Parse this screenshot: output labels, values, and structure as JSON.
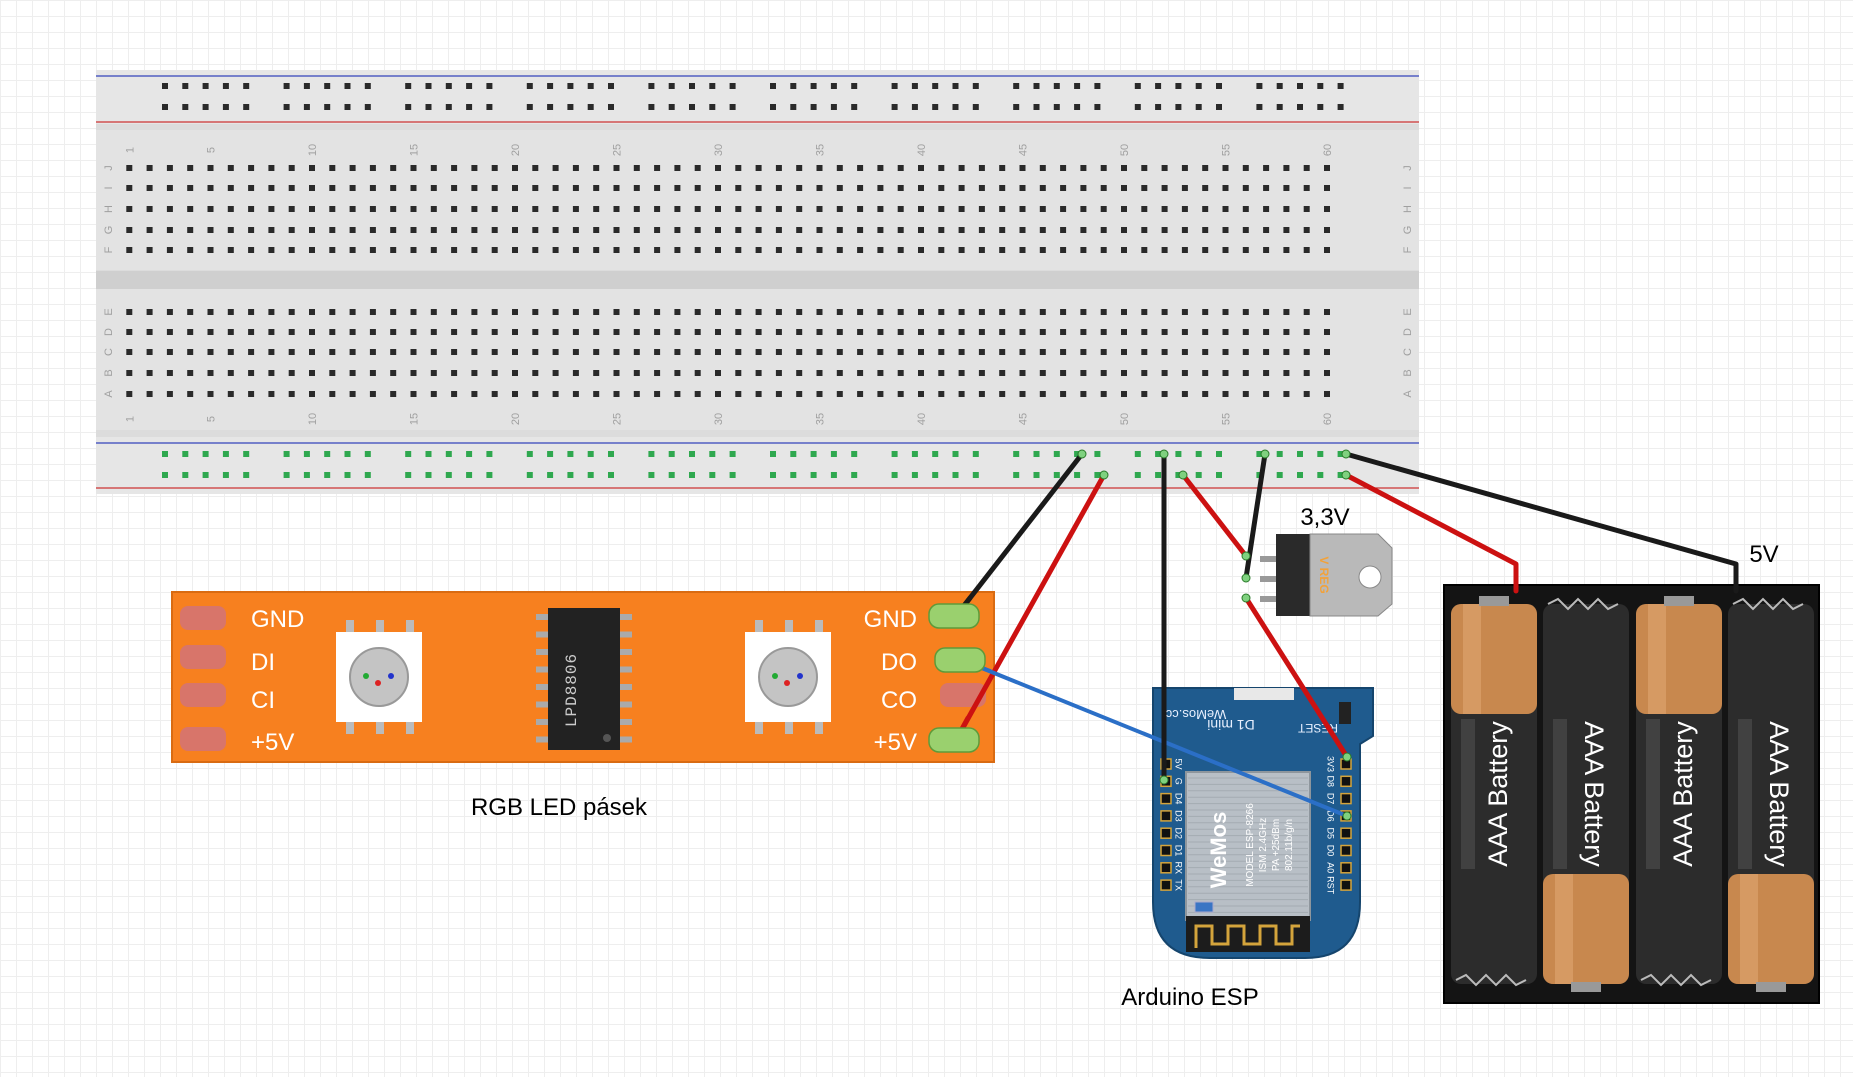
{
  "breadboard": {
    "column_numbers": [
      "1",
      "5",
      "10",
      "15",
      "20",
      "25",
      "30",
      "35",
      "40",
      "45",
      "50",
      "55",
      "60"
    ],
    "rows_top": [
      "J",
      "I",
      "H",
      "G",
      "F"
    ],
    "rows_bottom": [
      "E",
      "D",
      "C",
      "B",
      "A"
    ]
  },
  "led_strip": {
    "caption": "RGB LED pásek",
    "chip_label": "LPD8806",
    "left_pins": [
      "GND",
      "DI",
      "CI",
      "+5V"
    ],
    "right_pins": [
      "GND",
      "DO",
      "CO",
      "+5V"
    ]
  },
  "regulator": {
    "caption": "3,3V",
    "body_text": "V REG"
  },
  "board": {
    "caption": "Arduino ESP",
    "brand": "WeMos.cc",
    "model_name": "D1 mini",
    "reset_label": "RESET",
    "module_brand": "WeMos",
    "module_text": [
      "MODEL  ESP-8266",
      "ISM 2.4GHz",
      "PA +25dBm",
      "802.11b/g/n"
    ],
    "left_pins": [
      "5V",
      "G",
      "D4",
      "D3",
      "D2",
      "D1",
      "RX",
      "TX"
    ],
    "right_pins": [
      "3V3",
      "D8",
      "D7",
      "D6",
      "D5",
      "D0",
      "A0",
      "RST"
    ]
  },
  "battery_pack": {
    "caption": "5V",
    "cell_label": "AAA Battery"
  },
  "wire_colors": {
    "black": "#1a1a1a",
    "red": "#cc1111",
    "blue": "#2b6fc7"
  }
}
